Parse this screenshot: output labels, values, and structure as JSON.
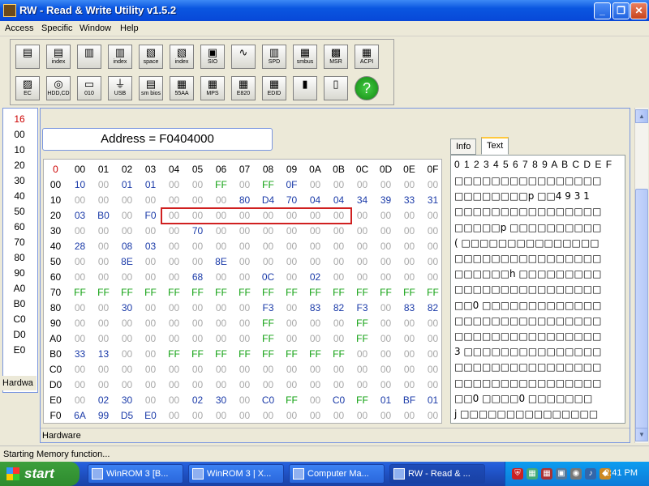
{
  "window": {
    "title": "RW - Read & Write Utility v1.5.2"
  },
  "menu": [
    "Access",
    "Specific",
    "Window",
    "Help"
  ],
  "toolbar": {
    "row1": [
      {
        "name": "pci-icon",
        "label": ""
      },
      {
        "name": "pci-index-icon",
        "label": "index"
      },
      {
        "name": "memory-icon",
        "label": ""
      },
      {
        "name": "memory-index-icon",
        "label": "index"
      },
      {
        "name": "io-space-icon",
        "label": "space"
      },
      {
        "name": "io-index-icon",
        "label": "index"
      },
      {
        "name": "sio-icon",
        "label": "SIO"
      },
      {
        "name": "waveform-icon",
        "label": ""
      },
      {
        "name": "spd-icon",
        "label": "SPD"
      },
      {
        "name": "smbus-icon",
        "label": "smbus"
      },
      {
        "name": "msr-icon",
        "label": "MSR"
      },
      {
        "name": "acpi-icon",
        "label": "ACPI"
      }
    ],
    "row2": [
      {
        "name": "ec-icon",
        "label": "EC"
      },
      {
        "name": "hdd-cd-icon",
        "label": "HDD,CD"
      },
      {
        "name": "disk-010-icon",
        "label": "010"
      },
      {
        "name": "usb-icon",
        "label": "USB"
      },
      {
        "name": "smbios-icon",
        "label": "sm bios"
      },
      {
        "name": "55aa-icon",
        "label": "55AA"
      },
      {
        "name": "mps-icon",
        "label": "MPS"
      },
      {
        "name": "e820-icon",
        "label": "E820"
      },
      {
        "name": "edid-icon",
        "label": "EDID"
      },
      {
        "name": "command-icon",
        "label": ""
      },
      {
        "name": "battery-icon",
        "label": ""
      },
      {
        "name": "help-icon",
        "label": ""
      }
    ]
  },
  "left_panel": {
    "rows": [
      "16",
      "00",
      "10",
      "20",
      "30",
      "40",
      "50",
      "60",
      "70",
      "80",
      "90",
      "A0",
      "B0",
      "C0",
      "D0",
      "E0",
      "F0"
    ],
    "footer": "Hardwa"
  },
  "main": {
    "address": "Address = F0404000",
    "corner": "0",
    "col_headers": [
      "00",
      "01",
      "02",
      "03",
      "04",
      "05",
      "06",
      "07",
      "08",
      "09",
      "0A",
      "0B",
      "0C",
      "0D",
      "0E",
      "0F"
    ],
    "rows": [
      {
        "label": "00",
        "cells": [
          "10",
          "00",
          "01",
          "01",
          "00",
          "00",
          "FF",
          "00",
          "FF",
          "0F",
          "00",
          "00",
          "00",
          "00",
          "00",
          "00"
        ]
      },
      {
        "label": "10",
        "cells": [
          "00",
          "00",
          "00",
          "00",
          "00",
          "00",
          "00",
          "80",
          "D4",
          "70",
          "04",
          "04",
          "34",
          "39",
          "33",
          "31"
        ]
      },
      {
        "label": "20",
        "cells": [
          "03",
          "B0",
          "00",
          "F0",
          "00",
          "00",
          "00",
          "00",
          "00",
          "00",
          "00",
          "00",
          "00",
          "00",
          "00",
          "00"
        ]
      },
      {
        "label": "30",
        "cells": [
          "00",
          "00",
          "00",
          "00",
          "00",
          "70",
          "00",
          "00",
          "00",
          "00",
          "00",
          "00",
          "00",
          "00",
          "00",
          "00"
        ]
      },
      {
        "label": "40",
        "cells": [
          "28",
          "00",
          "08",
          "03",
          "00",
          "00",
          "00",
          "00",
          "00",
          "00",
          "00",
          "00",
          "00",
          "00",
          "00",
          "00"
        ]
      },
      {
        "label": "50",
        "cells": [
          "00",
          "00",
          "8E",
          "00",
          "00",
          "00",
          "8E",
          "00",
          "00",
          "00",
          "00",
          "00",
          "00",
          "00",
          "00",
          "00"
        ]
      },
      {
        "label": "60",
        "cells": [
          "00",
          "00",
          "00",
          "00",
          "00",
          "68",
          "00",
          "00",
          "0C",
          "00",
          "02",
          "00",
          "00",
          "00",
          "00",
          "00"
        ]
      },
      {
        "label": "70",
        "cells": [
          "FF",
          "FF",
          "FF",
          "FF",
          "FF",
          "FF",
          "FF",
          "FF",
          "FF",
          "FF",
          "FF",
          "FF",
          "FF",
          "FF",
          "FF",
          "FF"
        ]
      },
      {
        "label": "80",
        "cells": [
          "00",
          "00",
          "30",
          "00",
          "00",
          "00",
          "00",
          "00",
          "F3",
          "00",
          "83",
          "82",
          "F3",
          "00",
          "83",
          "82"
        ]
      },
      {
        "label": "90",
        "cells": [
          "00",
          "00",
          "00",
          "00",
          "00",
          "00",
          "00",
          "00",
          "FF",
          "00",
          "00",
          "00",
          "FF",
          "00",
          "00",
          "00"
        ]
      },
      {
        "label": "A0",
        "cells": [
          "00",
          "00",
          "00",
          "00",
          "00",
          "00",
          "00",
          "00",
          "FF",
          "00",
          "00",
          "00",
          "FF",
          "00",
          "00",
          "00"
        ]
      },
      {
        "label": "B0",
        "cells": [
          "33",
          "13",
          "00",
          "00",
          "FF",
          "FF",
          "FF",
          "FF",
          "FF",
          "FF",
          "FF",
          "FF",
          "00",
          "00",
          "00",
          "00"
        ]
      },
      {
        "label": "C0",
        "cells": [
          "00",
          "00",
          "00",
          "00",
          "00",
          "00",
          "00",
          "00",
          "00",
          "00",
          "00",
          "00",
          "00",
          "00",
          "00",
          "00"
        ]
      },
      {
        "label": "D0",
        "cells": [
          "00",
          "00",
          "00",
          "00",
          "00",
          "00",
          "00",
          "00",
          "00",
          "00",
          "00",
          "00",
          "00",
          "00",
          "00",
          "00"
        ]
      },
      {
        "label": "E0",
        "cells": [
          "00",
          "02",
          "30",
          "00",
          "00",
          "02",
          "30",
          "00",
          "C0",
          "FF",
          "00",
          "C0",
          "FF",
          "01",
          "BF",
          "01"
        ]
      },
      {
        "label": "F0",
        "cells": [
          "6A",
          "99",
          "D5",
          "E0",
          "00",
          "00",
          "00",
          "00",
          "00",
          "00",
          "00",
          "00",
          "00",
          "00",
          "00",
          "00"
        ]
      }
    ],
    "footer": "Hardware"
  },
  "tabs": [
    {
      "label": "Info",
      "active": false
    },
    {
      "label": "Text",
      "active": true
    }
  ],
  "text_panel": {
    "header": "0 1 2 3 4 5 6 7 8 9 A B C D E F",
    "rows": [
      "□□□□□□□□□□□□□□□□",
      "□□□□□□□□p □□4 9 3 1",
      "□□□□□□□□□□□□□□□□",
      "□□□□□p □□□□□□□□□□",
      "( □□□□□□□□□□□□□□□",
      "□□□□□□□□□□□□□□□□",
      "□□□□□□h □□□□□□□□□",
      "□□□□□□□□□□□□□□□□",
      "□□0 □□□□□□□□□□□□□",
      "□□□□□□□□□□□□□□□□",
      "□□□□□□□□□□□□□□□□",
      "3 □□□□□□□□□□□□□□□",
      "□□□□□□□□□□□□□□□□",
      "□□□□□□□□□□□□□□□□",
      "□□0 □□□□0 □□□□□□□",
      "j □□□□□□□□□□□□□□□"
    ]
  },
  "status": "Starting Memory function...",
  "taskbar": {
    "start": "start",
    "tasks": [
      {
        "label": "WinROM 3 [B...",
        "active": false
      },
      {
        "label": "WinROM 3 | X...",
        "active": false
      },
      {
        "label": "Computer Ma...",
        "active": false
      },
      {
        "label": "RW - Read & ...",
        "active": true
      }
    ],
    "clock": "2:41 PM"
  },
  "colors": {
    "highlight_box": "#d02020",
    "ff_value": "#10a010",
    "nonzero_value": "#1a3aa8",
    "zero_value": "#a8a8a8"
  }
}
